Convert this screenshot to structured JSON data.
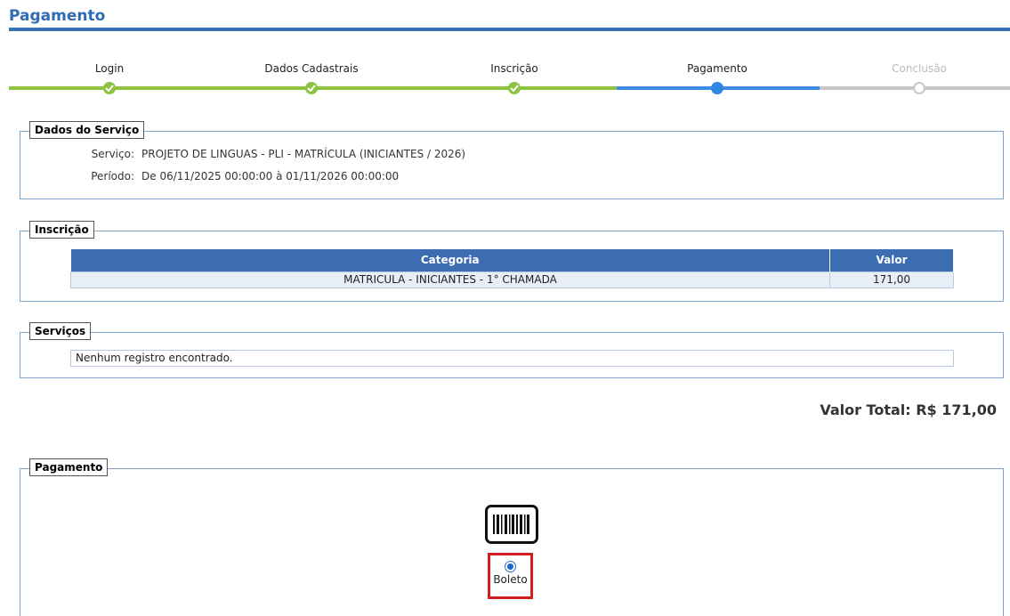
{
  "page": {
    "title": "Pagamento"
  },
  "stepper": {
    "steps": [
      {
        "label": "Login",
        "state": "done"
      },
      {
        "label": "Dados Cadastrais",
        "state": "done"
      },
      {
        "label": "Inscrição",
        "state": "done"
      },
      {
        "label": "Pagamento",
        "state": "active"
      },
      {
        "label": "Conclusão",
        "state": "pending"
      }
    ]
  },
  "service": {
    "legend": "Dados do Serviço",
    "service_label": "Serviço:",
    "service_value": "PROJETO DE LINGUAS - PLI - MATRÍCULA (INICIANTES / 2026)",
    "period_label": "Período:",
    "period_value": "De 06/11/2025 00:00:00 à 01/11/2026 00:00:00"
  },
  "inscription": {
    "legend": "Inscrição",
    "columns": [
      "Categoria",
      "Valor"
    ],
    "rows": [
      {
        "categoria": "MATRICULA - INICIANTES - 1° CHAMADA",
        "valor": "171,00"
      }
    ]
  },
  "services": {
    "legend": "Serviços",
    "empty_text": "Nenhum registro encontrado."
  },
  "total": {
    "text": "Valor Total: R$ 171,00"
  },
  "payment": {
    "legend": "Pagamento",
    "icon": "barcode-icon",
    "option_label": "Boleto",
    "selected": true
  },
  "colors": {
    "brand_blue": "#3a6fb7",
    "step_done": "#8cc33f",
    "step_active": "#2f86e5",
    "highlight_red": "#d01f1f"
  }
}
